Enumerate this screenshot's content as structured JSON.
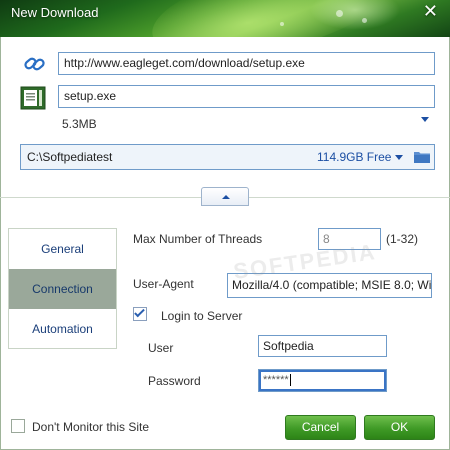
{
  "window": {
    "title": "New Download",
    "close_icon": "close-icon"
  },
  "download": {
    "url": "http://www.eagleget.com/download/setup.exe",
    "filename": "setup.exe",
    "size": "5.3MB"
  },
  "save_location": {
    "path": "C:\\Softpediatest",
    "free_space": "114.9GB Free"
  },
  "sidebar": {
    "items": [
      {
        "label": "General",
        "active": false
      },
      {
        "label": "Connection",
        "active": true
      },
      {
        "label": "Automation",
        "active": false
      }
    ]
  },
  "connection": {
    "threads_label": "Max Number of Threads",
    "threads_value": "8",
    "threads_range": "(1-32)",
    "user_agent_label": "User-Agent",
    "user_agent_value": "Mozilla/4.0 (compatible; MSIE 8.0; Wi",
    "login_label": "Login to Server",
    "login_checked": true,
    "user_label": "User",
    "user_value": "Softpedia",
    "password_label": "Password",
    "password_value": "******"
  },
  "footer": {
    "dont_monitor_label": "Don't Monitor this Site",
    "cancel_label": "Cancel",
    "ok_label": "OK"
  },
  "watermark": "SOFTPEDIA",
  "colors": {
    "accent_blue": "#1c4fa3",
    "button_green": "#3f9a26",
    "active_tab": "#9aa89a",
    "input_border": "#6f9bc9"
  }
}
